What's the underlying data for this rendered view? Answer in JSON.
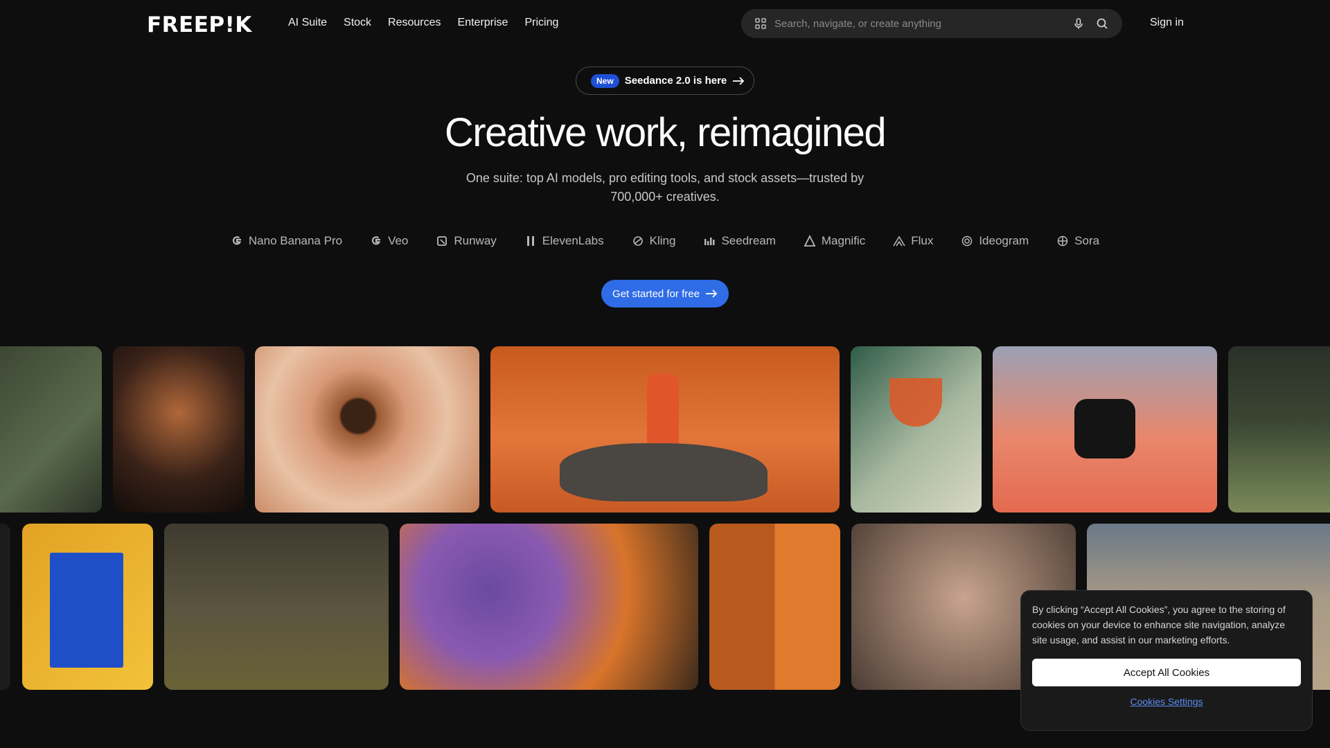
{
  "brand": {
    "logo": "FREEP!K"
  },
  "nav": {
    "items": [
      "AI Suite",
      "Stock",
      "Resources",
      "Enterprise",
      "Pricing"
    ]
  },
  "search": {
    "placeholder": "Search, navigate, or create anything"
  },
  "auth": {
    "signin": "Sign in"
  },
  "announcement": {
    "badge": "New",
    "text": "Seedance 2.0 is here"
  },
  "hero": {
    "title": "Creative work, reimagined",
    "subtitle": "One suite: top AI models, pro editing tools, and stock assets—trusted by 700,000+ creatives."
  },
  "models": [
    "Nano Banana Pro",
    "Veo",
    "Runway",
    "ElevenLabs",
    "Kling",
    "Seedream",
    "Magnific",
    "Flux",
    "Ideogram",
    "Sora"
  ],
  "cta": {
    "label": "Get started for free"
  },
  "cookie": {
    "text": "By clicking “Accept All Cookies”, you agree to the storing of cookies on your device to enhance site navigation, analyze site usage, and assist in our marketing efforts.",
    "accept": "Accept All Cookies",
    "settings": "Cookies Settings"
  },
  "colors": {
    "background": "#0e0e0e",
    "accent": "#2f6ce6",
    "badge": "#1f4fd6"
  },
  "icons": [
    "grid-icon",
    "mic-icon",
    "search-icon",
    "arrow-right-icon"
  ]
}
